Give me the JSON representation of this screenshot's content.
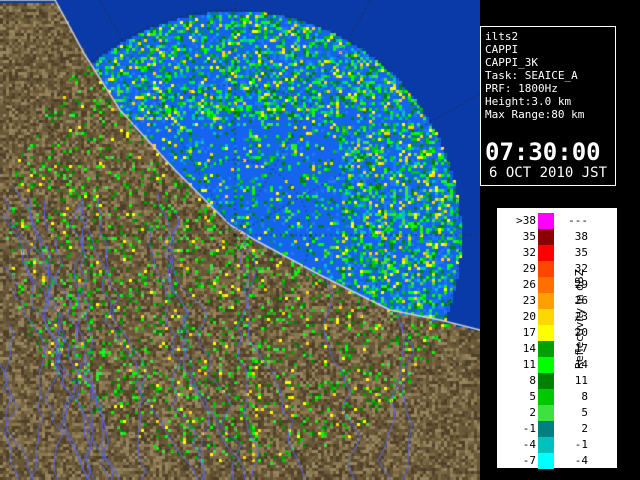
{
  "window": {
    "title": "ilts2"
  },
  "info": {
    "lines": [
      "ilts2",
      "CAPPI",
      "CAPPI_3K",
      "Task: SEAICE_A",
      "PRF: 1800Hz",
      "Height:3.0 km",
      "Max Range:80 km"
    ],
    "time": "07:30:00",
    "date": "6 OCT 2010 JST"
  },
  "legend": {
    "title": "Reflectivity in dBZ",
    "rows": [
      {
        "lo": ">38",
        "hi": "---",
        "color": "#ff00ff"
      },
      {
        "lo": "35",
        "hi": "38",
        "color": "#8b0000"
      },
      {
        "lo": "32",
        "hi": "35",
        "color": "#ff0000"
      },
      {
        "lo": "29",
        "hi": "32",
        "color": "#ff4500"
      },
      {
        "lo": "26",
        "hi": "29",
        "color": "#ff7000"
      },
      {
        "lo": "23",
        "hi": "26",
        "color": "#ffa000"
      },
      {
        "lo": "20",
        "hi": "23",
        "color": "#ffd700"
      },
      {
        "lo": "17",
        "hi": "20",
        "color": "#ffff00"
      },
      {
        "lo": "14",
        "hi": "17",
        "color": "#00a000"
      },
      {
        "lo": "11",
        "hi": "14",
        "color": "#00ff00"
      },
      {
        "lo": "8",
        "hi": "11",
        "color": "#008000"
      },
      {
        "lo": "5",
        "hi": "8",
        "color": "#00c800"
      },
      {
        "lo": "2",
        "hi": "5",
        "color": "#40e040"
      },
      {
        "lo": "-1",
        "hi": "2",
        "color": "#008080"
      },
      {
        "lo": "-4",
        "hi": "-1",
        "color": "#00c0c0"
      },
      {
        "lo": "-7",
        "hi": "-4",
        "color": "#00ffff"
      }
    ]
  },
  "map": {
    "land_color": "#6b5a3a",
    "sea_color": "#0a3aa8",
    "radar_sea_color": "#1464f0"
  }
}
